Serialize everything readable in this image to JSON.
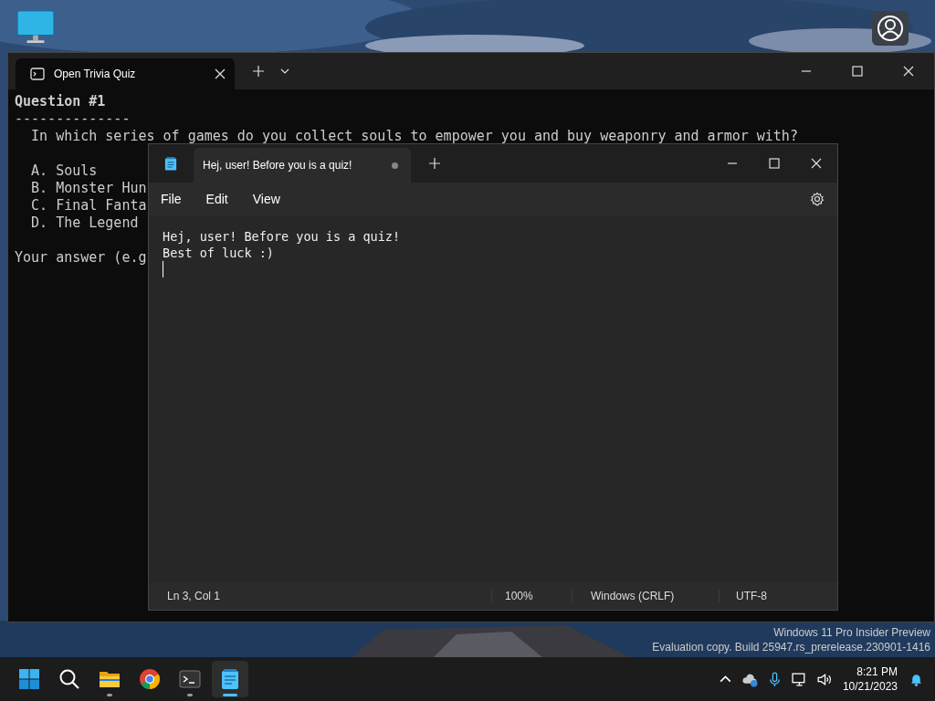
{
  "terminal": {
    "tab_title": "Open Trivia Quiz",
    "lines": [
      {
        "text": "Question #1"
      },
      {
        "text": "--------------"
      },
      {
        "text": "  In which series of games do you collect souls to empower you and buy weaponry and armor with?"
      },
      {
        "text": "  A. Souls"
      },
      {
        "text": "  B. Monster Hun"
      },
      {
        "text": "  C. Final Fanta"
      },
      {
        "text": "  D. The Legend"
      },
      {
        "text": "Your answer (e.g"
      }
    ]
  },
  "notepad": {
    "tab_title": "Hej, user! Before you is a quiz!",
    "unsaved": true,
    "menu": [
      "File",
      "Edit",
      "View"
    ],
    "text_lines": [
      "Hej, user! Before you is a quiz!",
      "Best of luck :)"
    ],
    "status": {
      "position": "Ln 3, Col 1",
      "zoom": "100%",
      "line_ending": "Windows (CRLF)",
      "encoding": "UTF-8"
    }
  },
  "watermark": [
    "Windows 11 Pro Insider Preview",
    "Evaluation copy. Build 25947.rs_prerelease.230901-1416"
  ],
  "taskbar": {
    "apps": [
      {
        "kind": "start",
        "running": false,
        "active": false
      },
      {
        "kind": "search",
        "running": false,
        "active": false
      },
      {
        "kind": "files",
        "running": true,
        "active": false
      },
      {
        "kind": "browser",
        "running": false,
        "active": false
      },
      {
        "kind": "terminal",
        "running": true,
        "active": false
      },
      {
        "kind": "notepad",
        "running": true,
        "active": true
      }
    ],
    "time": "8:21 PM",
    "date": "10/21/2023"
  }
}
